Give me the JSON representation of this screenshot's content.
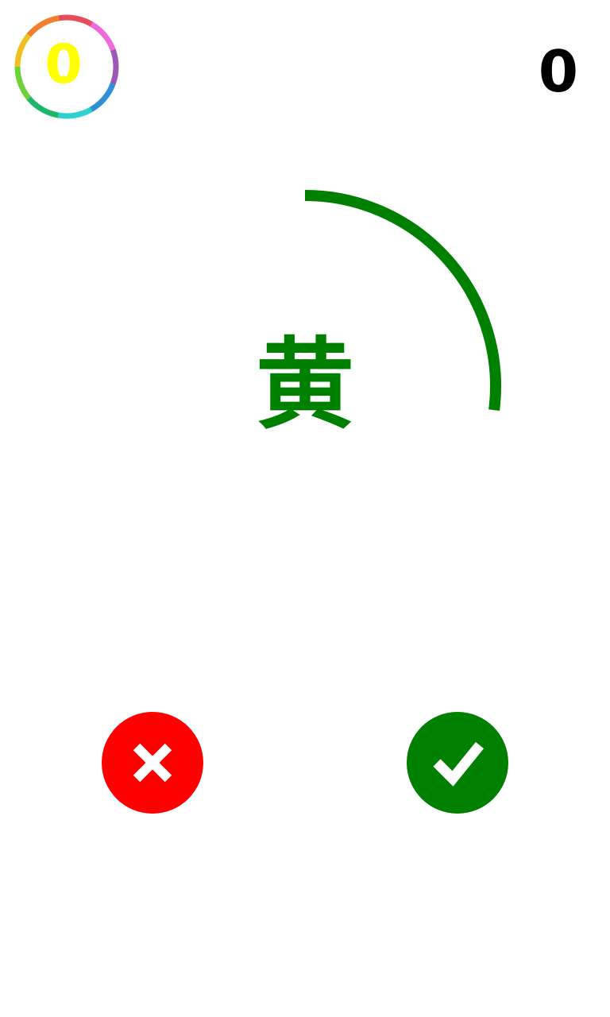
{
  "badge": {
    "value": "0",
    "value_color": "#ffff00",
    "ring_colors": [
      "#e84c5a",
      "#f06ad8",
      "#9b59b6",
      "#2f8fd8",
      "#2ed0d0",
      "#1fb86a",
      "#6fd13a",
      "#f0c020",
      "#f08030"
    ]
  },
  "score": "0",
  "timer": {
    "remaining_fraction": 0.27,
    "color": "#008000"
  },
  "word": {
    "text": "黄",
    "ink_color": "#008000"
  },
  "buttons": {
    "no": {
      "icon": "close-icon",
      "color": "#ff0000"
    },
    "yes": {
      "icon": "check-icon",
      "color": "#008000"
    }
  }
}
